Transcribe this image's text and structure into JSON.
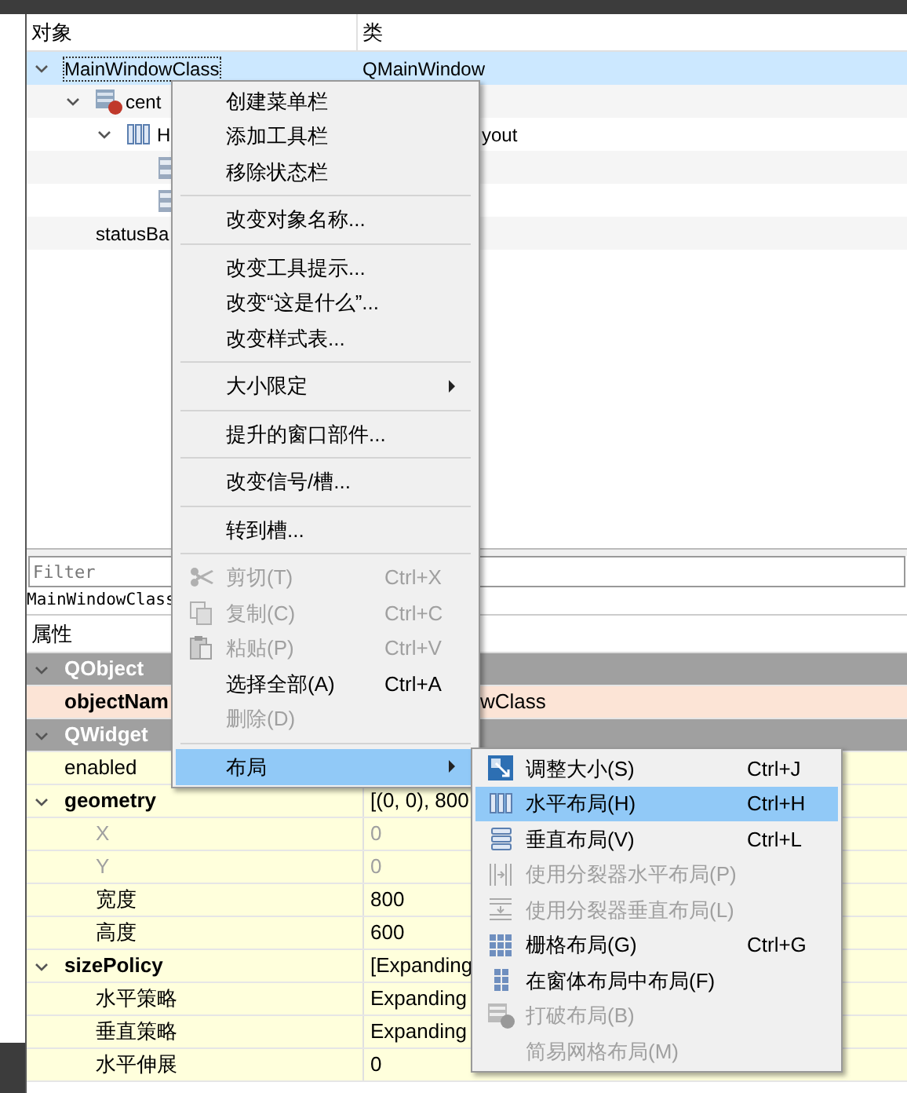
{
  "object_inspector": {
    "columns": [
      "对象",
      "类"
    ],
    "tree": [
      {
        "label": "MainWindowClass",
        "class": "QMainWindow",
        "expanded": true,
        "selected": true,
        "children": [
          {
            "kind": "widget",
            "label": "cent",
            "expanded": true,
            "selected": false,
            "children": [
              {
                "kind": "layout",
                "label": "H",
                "class": "yout",
                "class_clipped": true,
                "expanded": true,
                "selected": false,
                "children": [
                  {
                    "kind": "stacked",
                    "selected": false
                  },
                  {
                    "kind": "stacked",
                    "selected": false
                  }
                ]
              }
            ]
          },
          {
            "label": "statusBa",
            "selected": false
          }
        ]
      }
    ]
  },
  "property_editor": {
    "filter_placeholder": "Filter",
    "object_label": "MainWindowClass",
    "header": "属性",
    "groups": [
      {
        "name": "QObject",
        "expanded": true,
        "color": "#fce4d6",
        "properties": [
          {
            "name": "objectNam",
            "value": "wClass",
            "value_clipped": true,
            "changed": true,
            "disabled": false
          }
        ]
      },
      {
        "name": "QWidget",
        "expanded": true,
        "color": "#ffffdc",
        "properties": [
          {
            "name": "enabled",
            "changed": false,
            "disabled": false
          },
          {
            "name": "geometry",
            "value": "[(0, 0), 800",
            "changed": true,
            "disabled": false,
            "expanded": true,
            "children": [
              {
                "name": "X",
                "value": "0",
                "changed": false,
                "disabled": true
              },
              {
                "name": "Y",
                "value": "0",
                "changed": false,
                "disabled": true
              },
              {
                "name": "宽度",
                "value": "800",
                "changed": false,
                "disabled": false
              },
              {
                "name": "高度",
                "value": "600",
                "changed": false,
                "disabled": false
              }
            ]
          },
          {
            "name": "sizePolicy",
            "value": "[Expanding",
            "changed": true,
            "disabled": false,
            "expanded": true,
            "children": [
              {
                "name": "水平策略",
                "value": "Expanding",
                "changed": false,
                "disabled": false
              },
              {
                "name": "垂直策略",
                "value": "Expanding",
                "changed": false,
                "disabled": false
              },
              {
                "name": "水平伸展",
                "value": "0",
                "changed": false,
                "disabled": false
              }
            ]
          }
        ]
      }
    ]
  },
  "context_menu": {
    "items": [
      {
        "kind": "item",
        "label": "创建菜单栏",
        "disabled": false,
        "selected": false
      },
      {
        "kind": "item",
        "label": "添加工具栏",
        "disabled": false,
        "selected": false
      },
      {
        "kind": "item",
        "label": "移除状态栏",
        "disabled": false,
        "selected": false
      },
      {
        "kind": "separator"
      },
      {
        "kind": "item",
        "label": "改变对象名称...",
        "disabled": false,
        "selected": false
      },
      {
        "kind": "separator"
      },
      {
        "kind": "item",
        "label": "改变工具提示...",
        "disabled": false,
        "selected": false
      },
      {
        "kind": "item",
        "label": "改变“这是什么”...",
        "disabled": false,
        "selected": false
      },
      {
        "kind": "item",
        "label": "改变样式表...",
        "disabled": false,
        "selected": false
      },
      {
        "kind": "separator"
      },
      {
        "kind": "submenu",
        "label": "大小限定",
        "disabled": false,
        "selected": false
      },
      {
        "kind": "separator"
      },
      {
        "kind": "item",
        "label": "提升的窗口部件...",
        "disabled": false,
        "selected": false
      },
      {
        "kind": "separator"
      },
      {
        "kind": "item",
        "label": "改变信号/槽...",
        "disabled": false,
        "selected": false
      },
      {
        "kind": "separator"
      },
      {
        "kind": "item",
        "label": "转到槽...",
        "disabled": false,
        "selected": false
      },
      {
        "kind": "separator"
      },
      {
        "kind": "item",
        "label": "剪切(T)",
        "shortcut": "Ctrl+X",
        "disabled": true,
        "selected": false
      },
      {
        "kind": "item",
        "label": "复制(C)",
        "shortcut": "Ctrl+C",
        "disabled": true,
        "selected": false
      },
      {
        "kind": "item",
        "label": "粘贴(P)",
        "shortcut": "Ctrl+V",
        "disabled": true,
        "selected": false
      },
      {
        "kind": "item",
        "label": "选择全部(A)",
        "shortcut": "Ctrl+A",
        "disabled": false,
        "selected": false
      },
      {
        "kind": "item",
        "label": "删除(D)",
        "disabled": true,
        "selected": false
      },
      {
        "kind": "separator"
      },
      {
        "kind": "submenu",
        "label": "布局",
        "disabled": false,
        "selected": true
      }
    ]
  },
  "layout_submenu": {
    "items": [
      {
        "kind": "item",
        "label": "调整大小(S)",
        "shortcut": "Ctrl+J",
        "disabled": false,
        "selected": false
      },
      {
        "kind": "item",
        "label": "水平布局(H)",
        "shortcut": "Ctrl+H",
        "disabled": false,
        "selected": true
      },
      {
        "kind": "item",
        "label": "垂直布局(V)",
        "shortcut": "Ctrl+L",
        "disabled": false,
        "selected": false
      },
      {
        "kind": "item",
        "label": "使用分裂器水平布局(P)",
        "disabled": true,
        "selected": false
      },
      {
        "kind": "item",
        "label": "使用分裂器垂直布局(L)",
        "disabled": true,
        "selected": false
      },
      {
        "kind": "item",
        "label": "栅格布局(G)",
        "shortcut": "Ctrl+G",
        "disabled": false,
        "selected": false
      },
      {
        "kind": "item",
        "label": "在窗体布局中布局(F)",
        "disabled": false,
        "selected": false
      },
      {
        "kind": "item",
        "label": "打破布局(B)",
        "disabled": true,
        "selected": false
      },
      {
        "kind": "item",
        "label": "简易网格布局(M)",
        "disabled": true,
        "selected": false
      }
    ]
  }
}
